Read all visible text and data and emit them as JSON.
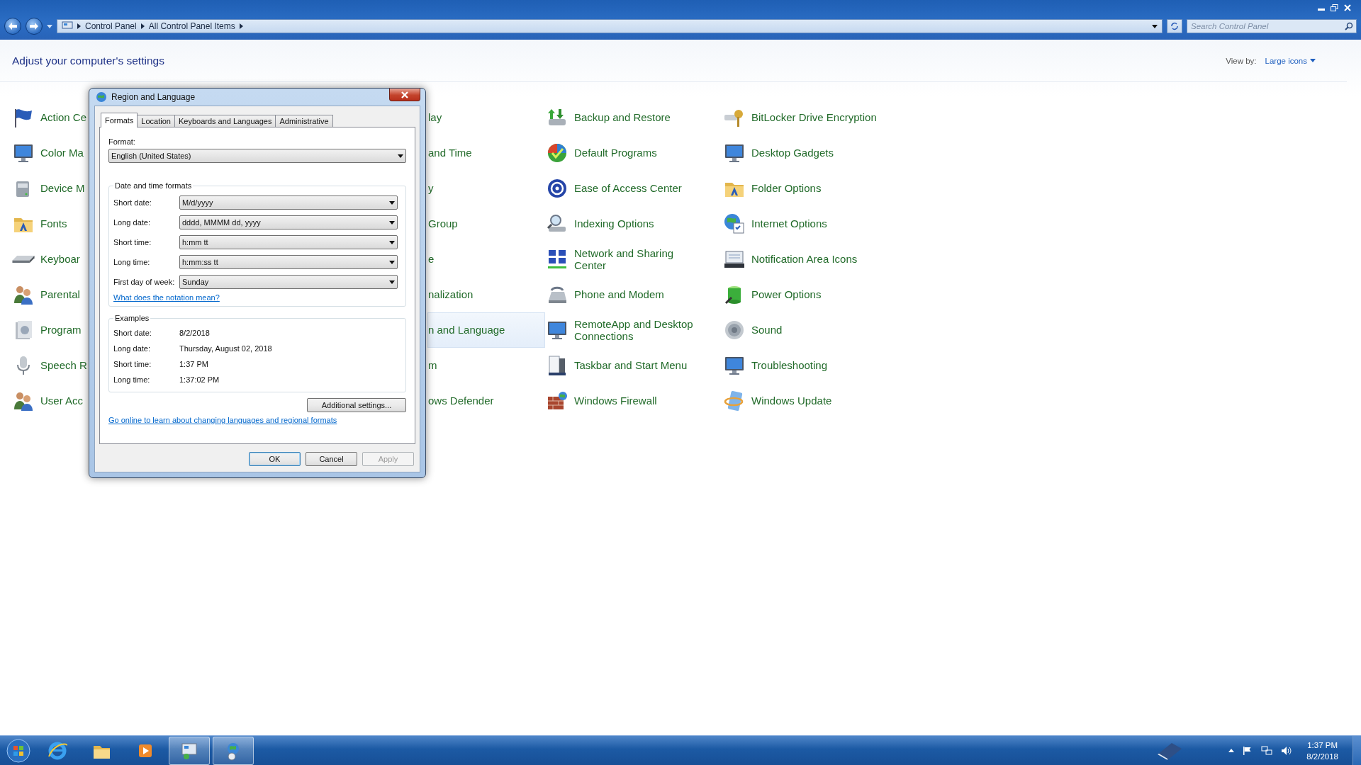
{
  "address_bar": {
    "breadcrumbs": [
      "Control Panel",
      "All Control Panel Items"
    ]
  },
  "search": {
    "placeholder": "Search Control Panel"
  },
  "header": {
    "title": "Adjust your computer's settings",
    "view_by_label": "View by:",
    "view_by_value": "Large icons"
  },
  "columns": [
    {
      "items": [
        {
          "label": "Action Ce",
          "selected": false
        },
        {
          "label": "Color Ma",
          "selected": false
        },
        {
          "label": "Device M",
          "selected": false
        },
        {
          "label": "Fonts",
          "selected": false
        },
        {
          "label": "Keyboar",
          "selected": false
        },
        {
          "label": "Parental",
          "selected": false
        },
        {
          "label": "Program",
          "selected": false
        },
        {
          "label": "Speech R",
          "selected": false
        },
        {
          "label": "User Acc",
          "selected": false
        }
      ]
    },
    {
      "items": [
        {
          "label": "lay",
          "selected": false
        },
        {
          "label": "and Time",
          "selected": false
        },
        {
          "label": "y",
          "selected": false
        },
        {
          "label": "Group",
          "selected": false
        },
        {
          "label": "e",
          "selected": false
        },
        {
          "label": "nalization",
          "selected": false
        },
        {
          "label": "n and Language",
          "selected": true
        },
        {
          "label": "m",
          "selected": false
        },
        {
          "label": "ows Defender",
          "selected": false
        }
      ]
    },
    {
      "items": [
        {
          "label": "Backup and Restore",
          "selected": false
        },
        {
          "label": "Default Programs",
          "selected": false
        },
        {
          "label": "Ease of Access Center",
          "selected": false
        },
        {
          "label": "Indexing Options",
          "selected": false
        },
        {
          "label": "Network and Sharing Center",
          "selected": false
        },
        {
          "label": "Phone and Modem",
          "selected": false
        },
        {
          "label": "RemoteApp and Desktop Connections",
          "selected": false
        },
        {
          "label": "Taskbar and Start Menu",
          "selected": false
        },
        {
          "label": "Windows Firewall",
          "selected": false
        }
      ]
    },
    {
      "items": [
        {
          "label": "BitLocker Drive Encryption",
          "selected": false
        },
        {
          "label": "Desktop Gadgets",
          "selected": false
        },
        {
          "label": "Folder Options",
          "selected": false
        },
        {
          "label": "Internet Options",
          "selected": false
        },
        {
          "label": "Notification Area Icons",
          "selected": false
        },
        {
          "label": "Power Options",
          "selected": false
        },
        {
          "label": "Sound",
          "selected": false
        },
        {
          "label": "Troubleshooting",
          "selected": false
        },
        {
          "label": "Windows Update",
          "selected": false
        }
      ]
    }
  ],
  "dialog": {
    "title": "Region and Language",
    "tabs": [
      {
        "label": "Formats",
        "selected": true
      },
      {
        "label": "Location",
        "selected": false
      },
      {
        "label": "Keyboards and Languages",
        "selected": false
      },
      {
        "label": "Administrative",
        "selected": false
      }
    ],
    "format_label": "Format:",
    "format_value": "English (United States)",
    "formats_group": {
      "title": "Date and time formats",
      "rows": [
        {
          "label": "Short date:",
          "value": "M/d/yyyy"
        },
        {
          "label": "Long date:",
          "value": "dddd, MMMM dd, yyyy"
        },
        {
          "label": "Short time:",
          "value": "h:mm tt"
        },
        {
          "label": "Long time:",
          "value": "h:mm:ss tt"
        },
        {
          "label": "First day of week:",
          "value": "Sunday"
        }
      ]
    },
    "notation_link": "What does the notation mean?",
    "examples_group": {
      "title": "Examples",
      "rows": [
        {
          "label": "Short date:",
          "value": "8/2/2018"
        },
        {
          "label": "Long date:",
          "value": "Thursday, August 02, 2018"
        },
        {
          "label": "Short time:",
          "value": "1:37 PM"
        },
        {
          "label": "Long time:",
          "value": "1:37:02 PM"
        }
      ]
    },
    "additional_button": "Additional settings...",
    "online_link": "Go online to learn about changing languages and regional formats",
    "buttons": [
      {
        "label": "OK",
        "default": true,
        "disabled": false
      },
      {
        "label": "Cancel",
        "default": false,
        "disabled": false
      },
      {
        "label": "Apply",
        "default": false,
        "disabled": true
      }
    ]
  },
  "taskbar": {
    "apps": [
      {
        "active": false
      },
      {
        "active": false
      },
      {
        "active": false
      },
      {
        "active": true
      },
      {
        "active": true
      }
    ],
    "clock": {
      "time": "1:37 PM",
      "date": "8/2/2018"
    }
  }
}
